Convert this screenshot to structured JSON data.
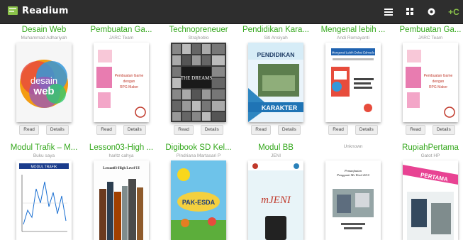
{
  "app": {
    "title": "Readium"
  },
  "toolbar": {
    "icons": [
      "list-view-icon",
      "grid-view-icon",
      "settings-icon",
      "add-book-icon"
    ],
    "add_label": "+C"
  },
  "buttons": {
    "read": "Read",
    "details": "Details"
  },
  "books": [
    {
      "title": "Desain Web",
      "author": "Muhammad Adhariyah",
      "cover_text": [
        "desain",
        "web"
      ]
    },
    {
      "title": "Pembuatan Ga...",
      "author": "JARC Team",
      "cover_text": [
        "Pembuatan Game",
        "dengan",
        "RPG Maker"
      ]
    },
    {
      "title": "Technopreneuer",
      "author": "Strajhoblo",
      "cover_text": [
        "THE DREAMS"
      ]
    },
    {
      "title": "Pendidikan Kara...",
      "author": "Siti Ansiyah",
      "cover_text": [
        "PENDIDIKAN",
        "KARAKTER"
      ]
    },
    {
      "title": "Mengenal lebih ...",
      "author": "Andi Romayanti",
      "cover_text": [
        "Mengenal Lebih Dekat Edmodo"
      ]
    },
    {
      "title": "Pembuatan Ga...",
      "author": "JARC Team",
      "cover_text": [
        "Pembuatan Game",
        "dengan",
        "RPG Maker"
      ]
    },
    {
      "title": "Modul Trafik – M...",
      "author": "Buku saya",
      "cover_text": [
        "MODUL TRAFIK"
      ]
    },
    {
      "title": "Lesson03-High ...",
      "author": "haritz cahya",
      "cover_text": [
        "Lesson03-High Level UI"
      ]
    },
    {
      "title": "Digibook SD Kel...",
      "author": "Pindriana Martasari P",
      "cover_text": [
        "PAK-ESDA"
      ]
    },
    {
      "title": "Modul BB",
      "author": "JENI",
      "cover_text": [
        "mJENI"
      ]
    },
    {
      "title": "",
      "author": "Unknown",
      "cover_text": [
        "Pemanfaatan",
        "Pengganti Ms Word 2010"
      ]
    },
    {
      "title": "RupiahPertama",
      "author": "Gatot HP",
      "cover_text": [
        "PERTAMA"
      ]
    }
  ]
}
